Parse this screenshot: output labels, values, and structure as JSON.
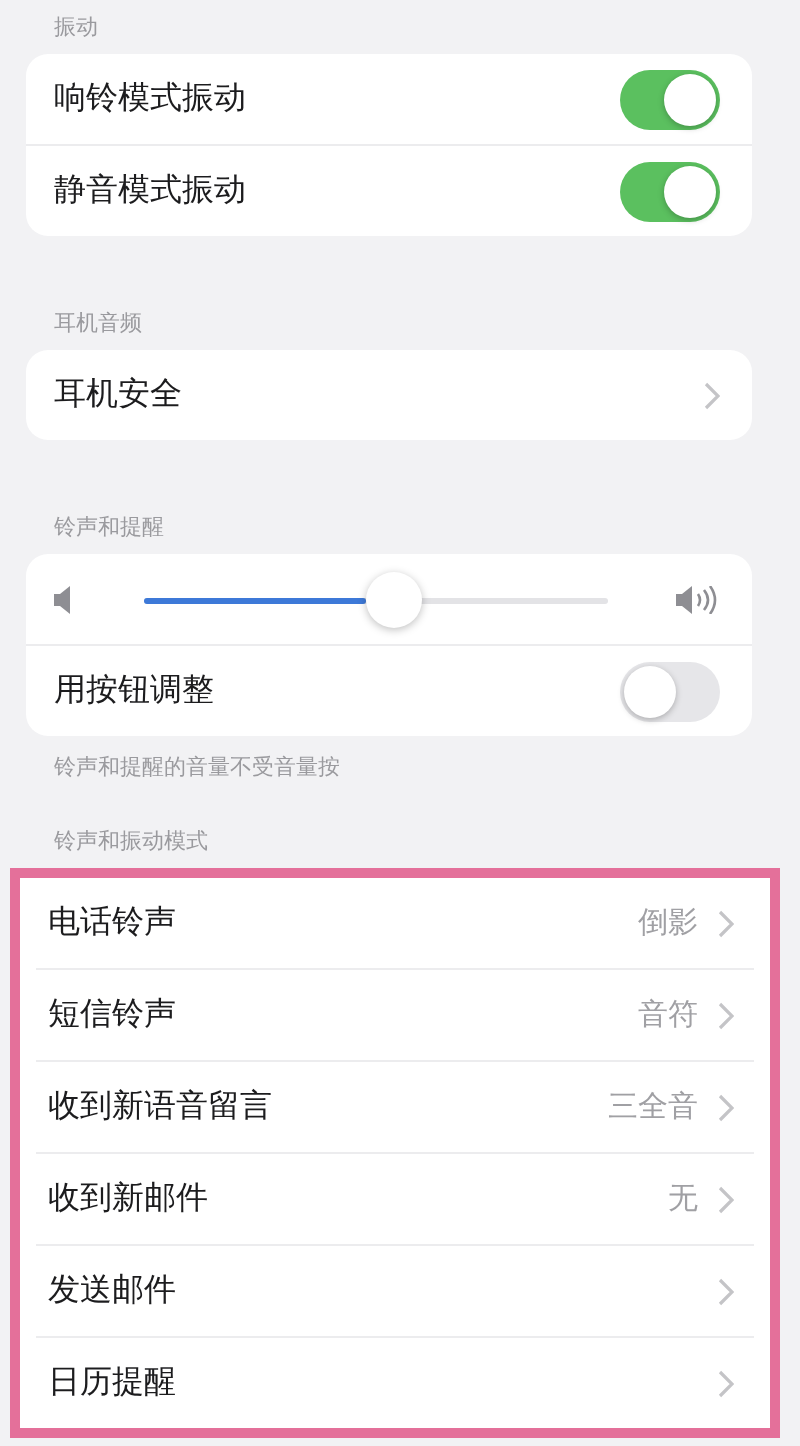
{
  "sections": [
    {
      "kind": "toggles",
      "header": "振动",
      "rows": [
        {
          "label": "响铃模式振动",
          "on": true
        },
        {
          "label": "静音模式振动",
          "on": true
        }
      ]
    },
    {
      "kind": "links",
      "header": "耳机音频",
      "rows": [
        {
          "label": "耳机安全"
        }
      ]
    },
    {
      "kind": "volume",
      "header": "铃声和提醒",
      "level": 0.48,
      "rows": [
        {
          "label": "用按钮调整",
          "on": false
        }
      ],
      "footer": "铃声和提醒的音量不受音量按"
    },
    {
      "kind": "links",
      "header": "铃声和振动模式",
      "highlighted": true,
      "rows": [
        {
          "label": "电话铃声",
          "value": "倒影"
        },
        {
          "label": "短信铃声",
          "value": "音符"
        },
        {
          "label": "收到新语音留言",
          "value": "三全音"
        },
        {
          "label": "收到新邮件",
          "value": "无"
        },
        {
          "label": "发送邮件"
        },
        {
          "label": "日历提醒"
        }
      ]
    }
  ]
}
